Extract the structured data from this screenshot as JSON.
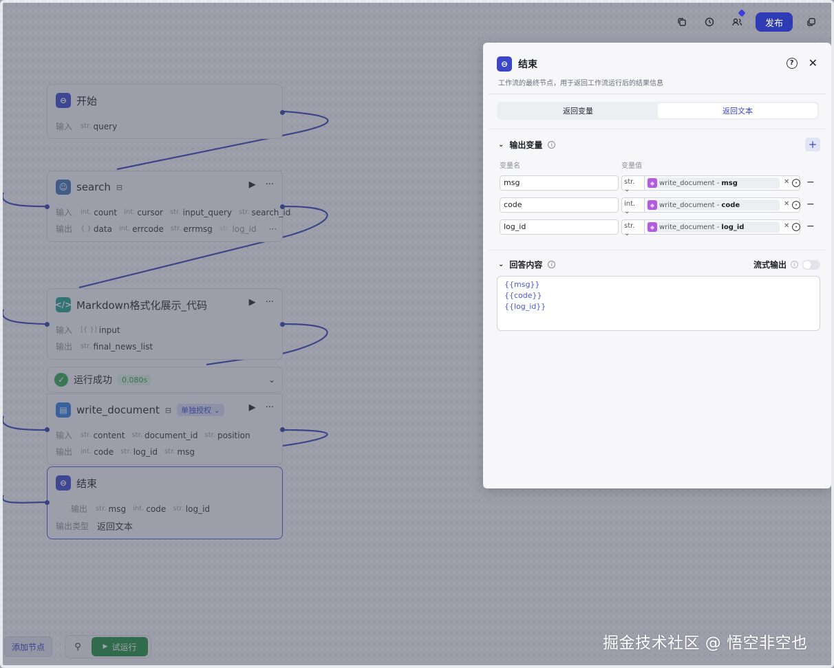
{
  "topbar": {
    "publish_label": "发布"
  },
  "nodes": {
    "start": {
      "title": "开始",
      "in_label": "输入",
      "in_tags": [
        {
          "type": "str.",
          "name": "query"
        }
      ]
    },
    "search": {
      "title": "search",
      "in_label": "输入",
      "in_tags": [
        {
          "type": "int.",
          "name": "count"
        },
        {
          "type": "int.",
          "name": "cursor"
        },
        {
          "type": "str.",
          "name": "input_query"
        },
        {
          "type": "str.",
          "name": "search_id"
        }
      ],
      "out_label": "输出",
      "out_tags": [
        {
          "type": "{ }",
          "name": "data"
        },
        {
          "type": "int.",
          "name": "errcode"
        },
        {
          "type": "str.",
          "name": "errmsg"
        },
        {
          "type": "str.",
          "name": "log_id"
        }
      ],
      "more": "···"
    },
    "markdown": {
      "title": "Markdown格式化展示_代码",
      "in_label": "输入",
      "in_tags": [
        {
          "type": "[{ }]",
          "name": "input"
        }
      ],
      "out_label": "输出",
      "out_tags": [
        {
          "type": "str.",
          "name": "final_news_list"
        }
      ]
    },
    "run_status": {
      "label": "运行成功",
      "time": "0.080s"
    },
    "write_document": {
      "title": "write_document",
      "auth_chip": "单独授权",
      "in_label": "输入",
      "in_tags": [
        {
          "type": "str.",
          "name": "content"
        },
        {
          "type": "str.",
          "name": "document_id"
        },
        {
          "type": "str.",
          "name": "position"
        }
      ],
      "out_label": "输出",
      "out_tags": [
        {
          "type": "int.",
          "name": "code"
        },
        {
          "type": "str.",
          "name": "log_id"
        },
        {
          "type": "str.",
          "name": "msg"
        }
      ]
    },
    "end": {
      "title": "结束",
      "out_label": "输出",
      "out_tags": [
        {
          "type": "str.",
          "name": "msg"
        },
        {
          "type": "int.",
          "name": "code"
        },
        {
          "type": "str.",
          "name": "log_id"
        }
      ],
      "out_type_label": "输出类型",
      "out_type_value": "返回文本"
    }
  },
  "bottom": {
    "add_node": "添加节点",
    "trial_run": "试运行"
  },
  "watermark": "掘金技术社区 @ 悟空非空也",
  "panel": {
    "title": "结束",
    "description": "工作流的最终节点，用于返回工作流运行后的结果信息",
    "tabs": [
      "返回变量",
      "返回文本"
    ],
    "active_tab": "返回文本",
    "output_section": "输出变量",
    "col_name": "变量名",
    "col_value": "变量值",
    "rows": [
      {
        "name": "msg",
        "type": "str.",
        "source": "write_document - ",
        "field": "msg"
      },
      {
        "name": "code",
        "type": "int.",
        "source": "write_document - ",
        "field": "code"
      },
      {
        "name": "log_id",
        "type": "str.",
        "source": "write_document - ",
        "field": "log_id"
      }
    ],
    "answer_section": "回答内容",
    "stream_label": "流式输出",
    "answer_lines": [
      "{{msg}}",
      "{{code}}",
      "{{log_id}}"
    ]
  },
  "colors": {
    "accent": "#2f3bb4",
    "success": "#1a8d3a",
    "ref_icon": "#b05be0"
  }
}
